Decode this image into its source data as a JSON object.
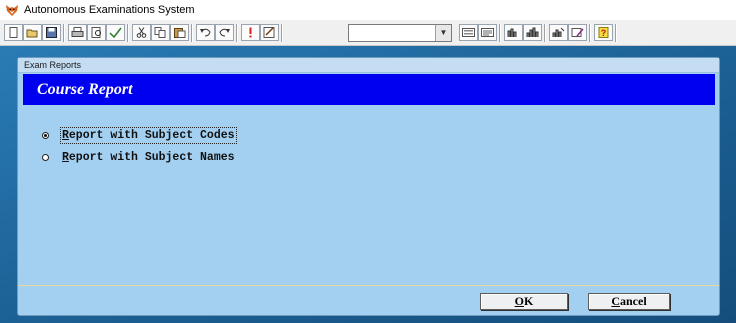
{
  "window": {
    "title": "Autonomous Examinations System",
    "icon": "fox-app-icon"
  },
  "toolbar": {
    "buttons": [
      {
        "name": "new-icon"
      },
      {
        "name": "open-icon"
      },
      {
        "name": "save-icon"
      },
      {
        "name": "print-icon"
      },
      {
        "name": "print-preview-icon"
      },
      {
        "name": "spell-check-icon"
      },
      {
        "name": "cut-icon"
      },
      {
        "name": "copy-icon"
      },
      {
        "name": "paste-icon"
      },
      {
        "name": "undo-icon"
      },
      {
        "name": "redo-icon"
      },
      {
        "name": "run-icon"
      },
      {
        "name": "modify-form-icon"
      },
      {
        "name": "form-icon"
      },
      {
        "name": "report-icon"
      },
      {
        "name": "database-icon"
      },
      {
        "name": "chart-icon"
      },
      {
        "name": "tools-icon"
      },
      {
        "name": "wizard-icon"
      },
      {
        "name": "help-icon"
      }
    ],
    "combo_value": ""
  },
  "dialog": {
    "title": "Exam Reports",
    "banner": "Course Report",
    "options": [
      {
        "hotkey": "R",
        "rest": "eport with Subject Codes",
        "selected": true
      },
      {
        "hotkey": "R",
        "rest": "eport with Subject Names",
        "selected": false
      }
    ],
    "ok": {
      "hotkey": "O",
      "rest": "K"
    },
    "cancel": {
      "hotkey": "C",
      "rest": "ancel"
    }
  },
  "colors": {
    "banner": "#0000f0",
    "dialog_body": "#a3cff0",
    "workspace": "#1e6ea8"
  }
}
